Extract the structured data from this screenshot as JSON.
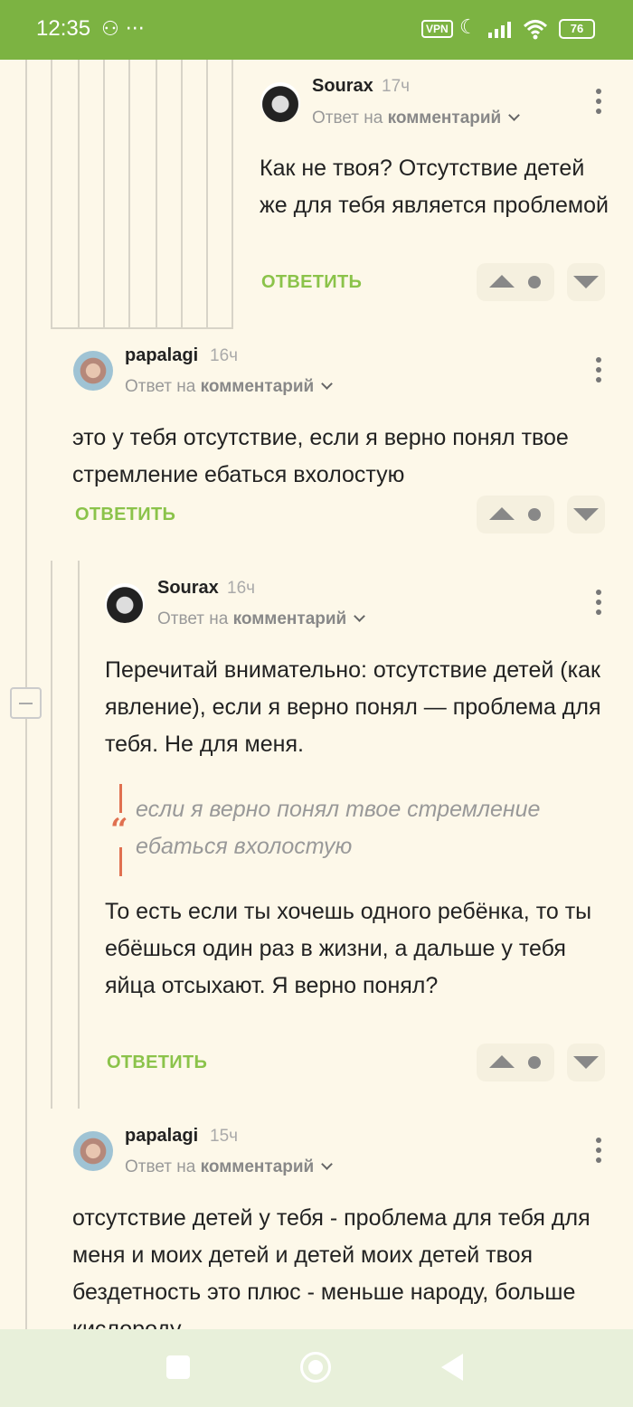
{
  "status_bar": {
    "time": "12:35",
    "left_icons": "⚇ ···",
    "vpn": "VPN",
    "battery": "76"
  },
  "comments": [
    {
      "author": "Sourax",
      "age": "17ч",
      "reply_prefix": "Ответ на",
      "reply_target": "комментарий",
      "text": "Как не твоя? Отсутствие детей же для тебя является проблемой",
      "reply_label": "ОТВЕТИТЬ"
    },
    {
      "author": "papalagi",
      "age": "16ч",
      "reply_prefix": "Ответ на",
      "reply_target": "комментарий",
      "text": "это у тебя отсутствие, если я верно понял твое стремление ебаться вхолостую",
      "reply_label": "ОТВЕТИТЬ"
    },
    {
      "author": "Sourax",
      "age": "16ч",
      "reply_prefix": "Ответ на",
      "reply_target": "комментарий",
      "text": "Перечитай внимательно: отсутствие детей (как явление), если я верно понял — проблема для тебя. Не для меня.",
      "quote": "если я верно понял твое стремление ебаться вхолостую",
      "text2": "То есть если ты хочешь одного ребёнка, то ты ебёшься один раз в жизни, а дальше у тебя яйца отсыхают. Я верно понял?",
      "reply_label": "ОТВЕТИТЬ"
    },
    {
      "author": "papalagi",
      "age": "15ч",
      "reply_prefix": "Ответ на",
      "reply_target": "комментарий",
      "text": "отсутствие детей у тебя - проблема для тебя для меня и моих детей и детей моих детей твоя бездетность это плюс - меньше народу, больше кислороду"
    }
  ],
  "quote_glyph": "“"
}
